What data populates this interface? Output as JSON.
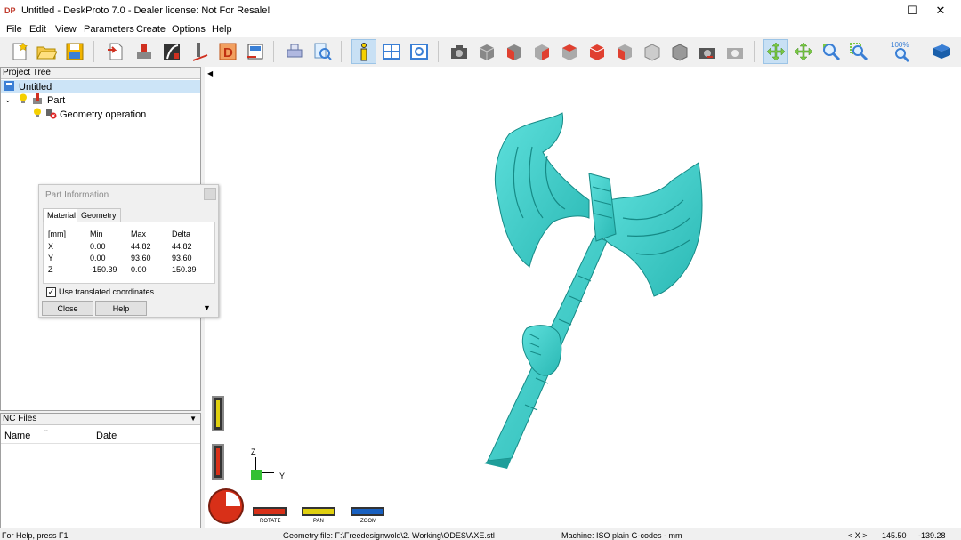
{
  "window": {
    "title": "Untitled - DeskProto 7.0 - Dealer license: Not For Resale!",
    "icon_text": "DP",
    "minimize": "—",
    "maximize": "☐",
    "close": "✕"
  },
  "menu": [
    "File",
    "Edit",
    "View",
    "Parameters",
    "Create",
    "Options",
    "Help"
  ],
  "toolbar": {
    "zoom_level": "100%"
  },
  "project_tree": {
    "header": "Project Tree",
    "root": "Untitled",
    "part": "Part",
    "geometry_operation": "Geometry operation"
  },
  "nc_files": {
    "header": "NC Files",
    "col_name": "Name",
    "col_date": "Date"
  },
  "part_info": {
    "title": "Part Information",
    "tab_material": "Material",
    "tab_geometry": "Geometry",
    "headers": [
      "[mm]",
      "Min",
      "Max",
      "Delta"
    ],
    "rows": [
      [
        "X",
        "0.00",
        "44.82",
        "44.82"
      ],
      [
        "Y",
        "0.00",
        "93.60",
        "93.60"
      ],
      [
        "Z",
        "-150.39",
        "0.00",
        "150.39"
      ]
    ],
    "checkbox_label": "Use translated coordinates",
    "checkbox_checked": true,
    "close_button": "Close",
    "help_button": "Help"
  },
  "viewport": {
    "axis_z": "Z",
    "axis_y": "Y",
    "rotate_label": "ROTATE",
    "pan_label": "PAN",
    "zoom_label": "ZOOM"
  },
  "status": {
    "help": "For Help, press F1",
    "geometry_file": "Geometry file: F:\\Freedesignwold\\2. Working\\ODES\\AXE.stl",
    "machine": "Machine: ISO plain G-codes - mm",
    "coord_label": "< X >",
    "coord_x": "145.50",
    "coord_y": "-139.28"
  },
  "colors": {
    "model": "#40d0cc",
    "accent": "#c8e0f4",
    "rotate": "#d83018",
    "pan": "#e0d010",
    "zoom": "#1860c0"
  }
}
